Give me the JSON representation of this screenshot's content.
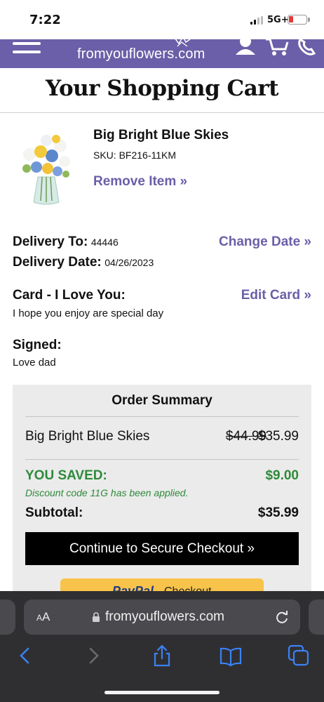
{
  "status_bar": {
    "time": "7:22",
    "network": "5G+",
    "battery_level": 0.15,
    "battery_color": "#e53935"
  },
  "header": {
    "logo_text": "fromyouflowers.com",
    "brand_color": "#6a5fa8",
    "icons": [
      "menu-icon",
      "account-icon",
      "cart-icon",
      "phone-icon"
    ]
  },
  "page": {
    "title": "Your Shopping Cart"
  },
  "product": {
    "name": "Big Bright Blue Skies",
    "sku": "SKU: BF216-11KM",
    "remove_label": "Remove Item »"
  },
  "delivery": {
    "to_label": "Delivery To:",
    "to_value": "44446",
    "date_label": "Delivery Date:",
    "date_value": "04/26/2023",
    "change_date_label": "Change Date »"
  },
  "card": {
    "label": "Card - I Love You:",
    "message": "I hope you enjoy are special day",
    "edit_label": "Edit Card »",
    "signed_label": "Signed:",
    "signed_value": "Love dad"
  },
  "summary": {
    "title": "Order Summary",
    "item_name": "Big Bright Blue Skies",
    "original_price": "$44.99",
    "price": "$35.99",
    "saved_label": "YOU SAVED:",
    "saved_value": "$9.00",
    "discount_note": "Discount code 11G has been applied.",
    "subtotal_label": "Subtotal:",
    "subtotal_value": "$35.99",
    "checkout_label": "Continue to Secure Checkout »",
    "paypal_label": "PayPal",
    "paypal_suffix": "Checkout",
    "saved_color": "#2e8a3a"
  },
  "browser": {
    "text_size_label": "AA",
    "url": "fromyouflowers.com",
    "nav_icons": [
      "back-icon",
      "forward-icon",
      "share-icon",
      "bookmarks-icon",
      "tabs-icon"
    ]
  }
}
